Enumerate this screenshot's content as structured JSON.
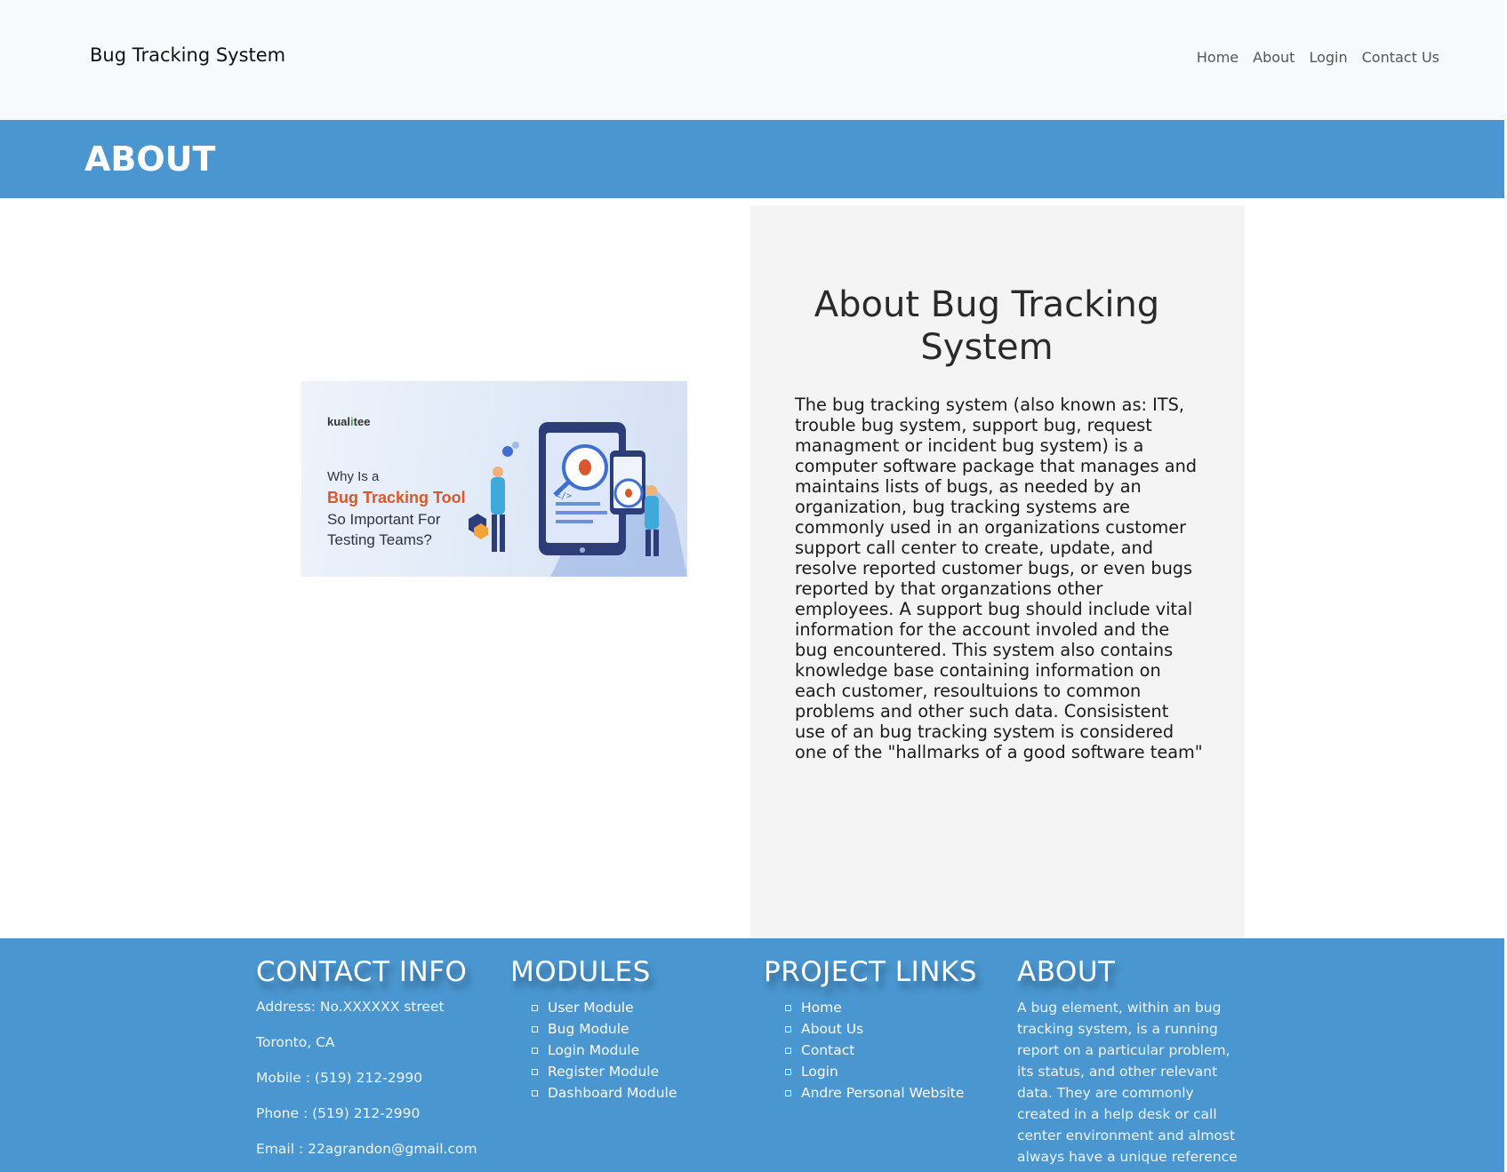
{
  "navbar": {
    "brand": "Bug Tracking System",
    "links": [
      "Home",
      "About",
      "Login",
      "Contact Us"
    ]
  },
  "banner": {
    "title": "ABOUT"
  },
  "illustration": {
    "logo": "kualitee",
    "line1": "Why Is a",
    "line2": "Bug Tracking Tool",
    "line3": "So Important For",
    "line4": "Testing Teams?"
  },
  "about": {
    "title": "About Bug Tracking System",
    "body": "The bug tracking system (also known as: ITS, trouble bug system, support bug, request managment or incident bug system) is a computer software package that manages and maintains lists of bugs, as needed by an organization, bug tracking systems are commonly used in an organizations customer support call center to create, update, and resolve reported customer bugs, or even bugs reported by that organzations other employees. A support bug should include vital information for the account involed and the bug encountered. This system also contains knowledge base containing information on each customer, resoultuions to common problems and other such data. Consisistent use of an bug tracking system is considered one of the \"hallmarks of a good software team\""
  },
  "footer": {
    "contact": {
      "heading": "CONTACT INFO",
      "address": "Address: No.XXXXXX street",
      "city": "Toronto, CA",
      "mobile": "Mobile : (519) 212-2990",
      "phone": "Phone : (519) 212-2990",
      "email": "Email : 22agrandon@gmail.com"
    },
    "modules": {
      "heading": "MODULES",
      "items": [
        "User Module",
        "Bug Module",
        "Login Module",
        "Register Module",
        "Dashboard Module"
      ]
    },
    "links": {
      "heading": "PROJECT LINKS",
      "items": [
        "Home",
        "About Us",
        "Contact",
        "Login",
        "Andre Personal Website"
      ]
    },
    "about": {
      "heading": "ABOUT",
      "text": "A bug element, within an bug tracking system, is a running report on a particular problem, its status, and other relevant data. They are commonly created in a help desk or call center environment and almost always have a unique reference"
    }
  },
  "colors": {
    "primary": "#4a96d0",
    "navbar_bg": "#f8f9fa",
    "card_bg": "#f4f4f4"
  }
}
